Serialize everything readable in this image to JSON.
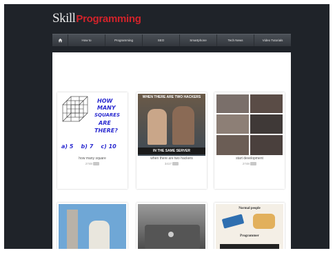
{
  "header": {
    "logo_word1": "Skill",
    "logo_word2": "Programming"
  },
  "nav": {
    "home_icon": "home-icon",
    "items": [
      "How to",
      "Programming",
      "SEO",
      "Smartphone",
      "Tech News",
      "Video Tutorials"
    ]
  },
  "cards": [
    {
      "title": "how many square",
      "views": "2748",
      "tag": "",
      "image_text": {
        "q1": "HOW",
        "q2": "MANY",
        "q3": "SQUARES",
        "q4": "ARE",
        "q5": "THERE?",
        "answers": "a) 5    b) 7    c) 10"
      }
    },
    {
      "title": "when there are two hackers",
      "views": "3417",
      "tag": "",
      "image_text": {
        "top": "WHEN THERE ARE TWO HACKERS",
        "bottom": "IN THE SAME SERVER"
      }
    },
    {
      "title": "start development",
      "views": "2748",
      "tag": ""
    }
  ],
  "cards_row2": [
    {
      "image_text": {}
    },
    {
      "image_text": {}
    },
    {
      "image_text": {
        "top": "Normal people",
        "bottom": "Programmer"
      }
    }
  ],
  "colors": {
    "page_bg": "#1f2329",
    "logo_accent": "#d2232a",
    "nav_bg": "#3d4248"
  }
}
